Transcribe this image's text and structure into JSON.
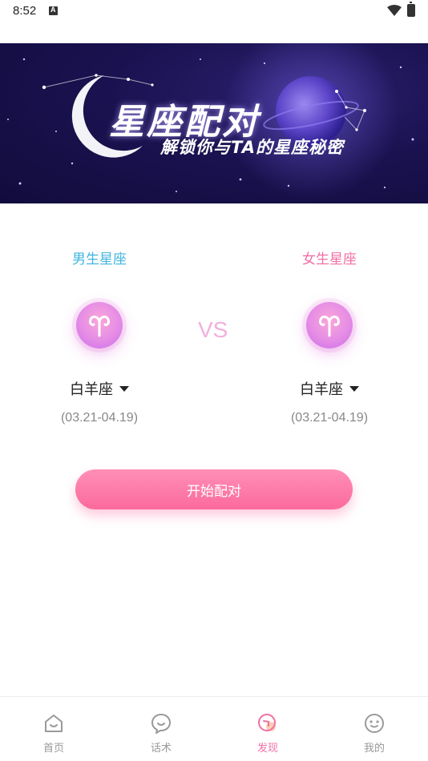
{
  "status_bar": {
    "time": "8:52",
    "notification_letter": "A"
  },
  "banner": {
    "title": "星座配对",
    "subtitle": "解锁你与TA的星座秘密"
  },
  "male": {
    "label": "男生星座",
    "sign": "白羊座",
    "dates": "(03.21-04.19)",
    "label_color": "#3fb5e0"
  },
  "female": {
    "label": "女生星座",
    "sign": "白羊座",
    "dates": "(03.21-04.19)",
    "label_color": "#f06fa5"
  },
  "vs_text": "VS",
  "start_button": {
    "label": "开始配对"
  },
  "tabs": [
    {
      "label": "首页",
      "icon": "home-face-icon",
      "active": false
    },
    {
      "label": "话术",
      "icon": "chat-face-icon",
      "active": false
    },
    {
      "label": "发现",
      "icon": "discover-icon",
      "active": true
    },
    {
      "label": "我的",
      "icon": "profile-face-icon",
      "active": false
    }
  ],
  "colors": {
    "accent": "#f06fa5",
    "button_gradient_top": "#ff8fb6",
    "button_gradient_bottom": "#fb6a9c",
    "male_accent": "#3fb5e0",
    "banner_bg": "#1a1250"
  }
}
